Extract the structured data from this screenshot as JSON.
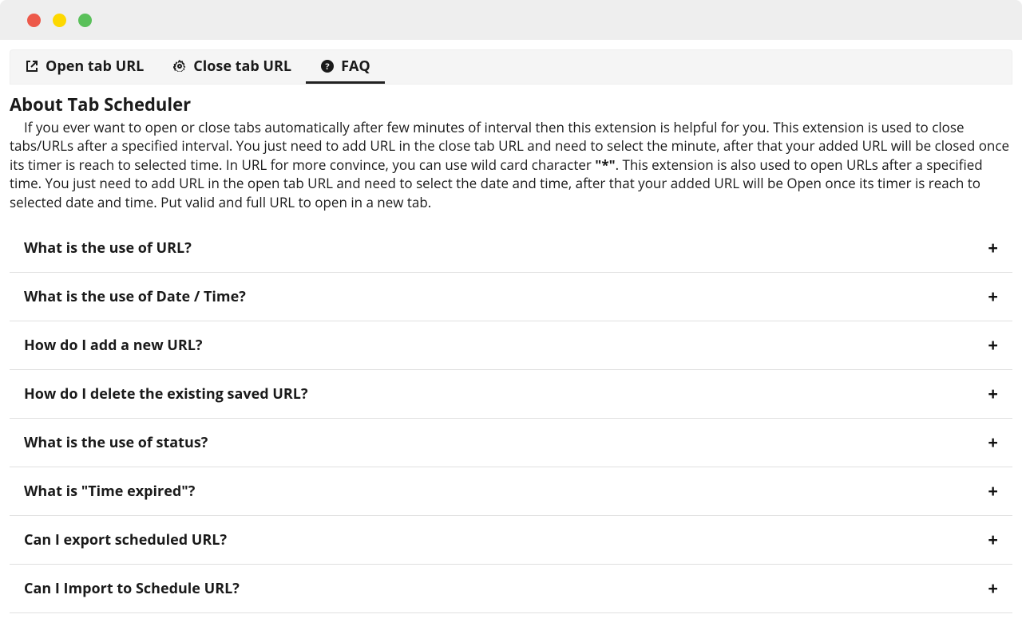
{
  "tabs": [
    {
      "label": "Open tab URL"
    },
    {
      "label": "Close tab URL"
    },
    {
      "label": "FAQ"
    }
  ],
  "about": {
    "title": "About Tab Scheduler",
    "desc_part1": "If you ever want to open or close tabs automatically after few minutes of interval then this extension is helpful for you. This extension is used to close tabs/URLs after a specified interval. You just need to add URL in the close tab URL and need to select the minute, after that your added URL will be closed once its timer is reach to selected time. In URL for more convince, you can use wild card character ",
    "desc_bold": "\"*\"",
    "desc_part2": ". This extension is also used to open URLs after a specified time. You just need to add URL in the open tab URL and need to select the date and time, after that your added URL will be Open once its timer is reach to selected date and time. Put valid and full URL to open in a new tab."
  },
  "faq": [
    {
      "q": "What is the use of URL?"
    },
    {
      "q": "What is the use of Date / Time?"
    },
    {
      "q": "How do I add a new URL?"
    },
    {
      "q": "How do I delete the existing saved URL?"
    },
    {
      "q": "What is the use of status?"
    },
    {
      "q": "What is \"Time expired\"?"
    },
    {
      "q": "Can I export scheduled URL?"
    },
    {
      "q": "Can I Import to Schedule URL?"
    }
  ],
  "icons": {
    "plus": "+"
  }
}
